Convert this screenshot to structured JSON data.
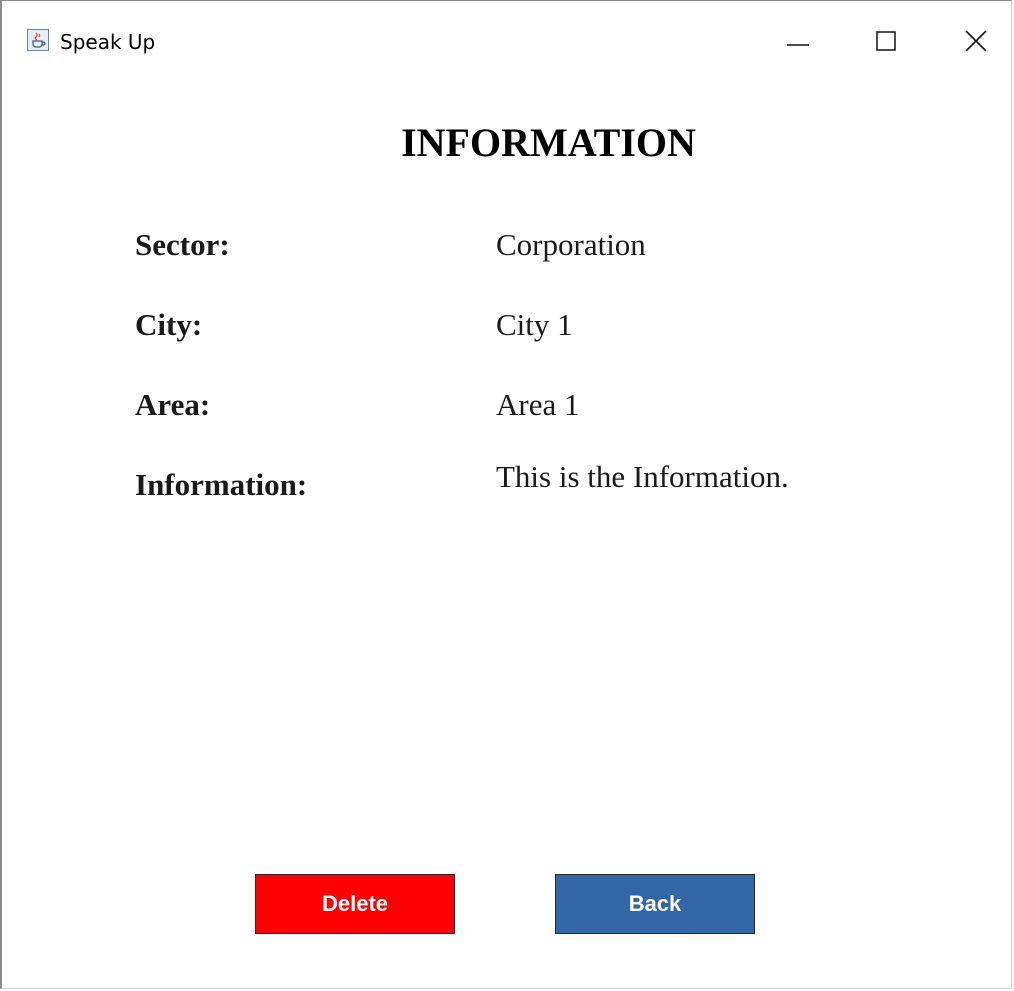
{
  "window": {
    "title": "Speak Up",
    "icon": "java-cup-icon"
  },
  "controls": {
    "minimize": "minimize-icon",
    "maximize": "maximize-icon",
    "close": "close-icon"
  },
  "heading": "INFORMATION",
  "fields": {
    "sector": {
      "label": "Sector:",
      "value": "Corporation"
    },
    "city": {
      "label": "City:",
      "value": "City 1"
    },
    "area": {
      "label": "Area:",
      "value": "Area 1"
    },
    "information": {
      "label": "Information:",
      "value": "This is the Information."
    }
  },
  "buttons": {
    "delete": "Delete",
    "back": "Back"
  },
  "colors": {
    "delete_bg": "#ff0000",
    "back_bg": "#3366a8",
    "button_text": "#ffffff"
  }
}
